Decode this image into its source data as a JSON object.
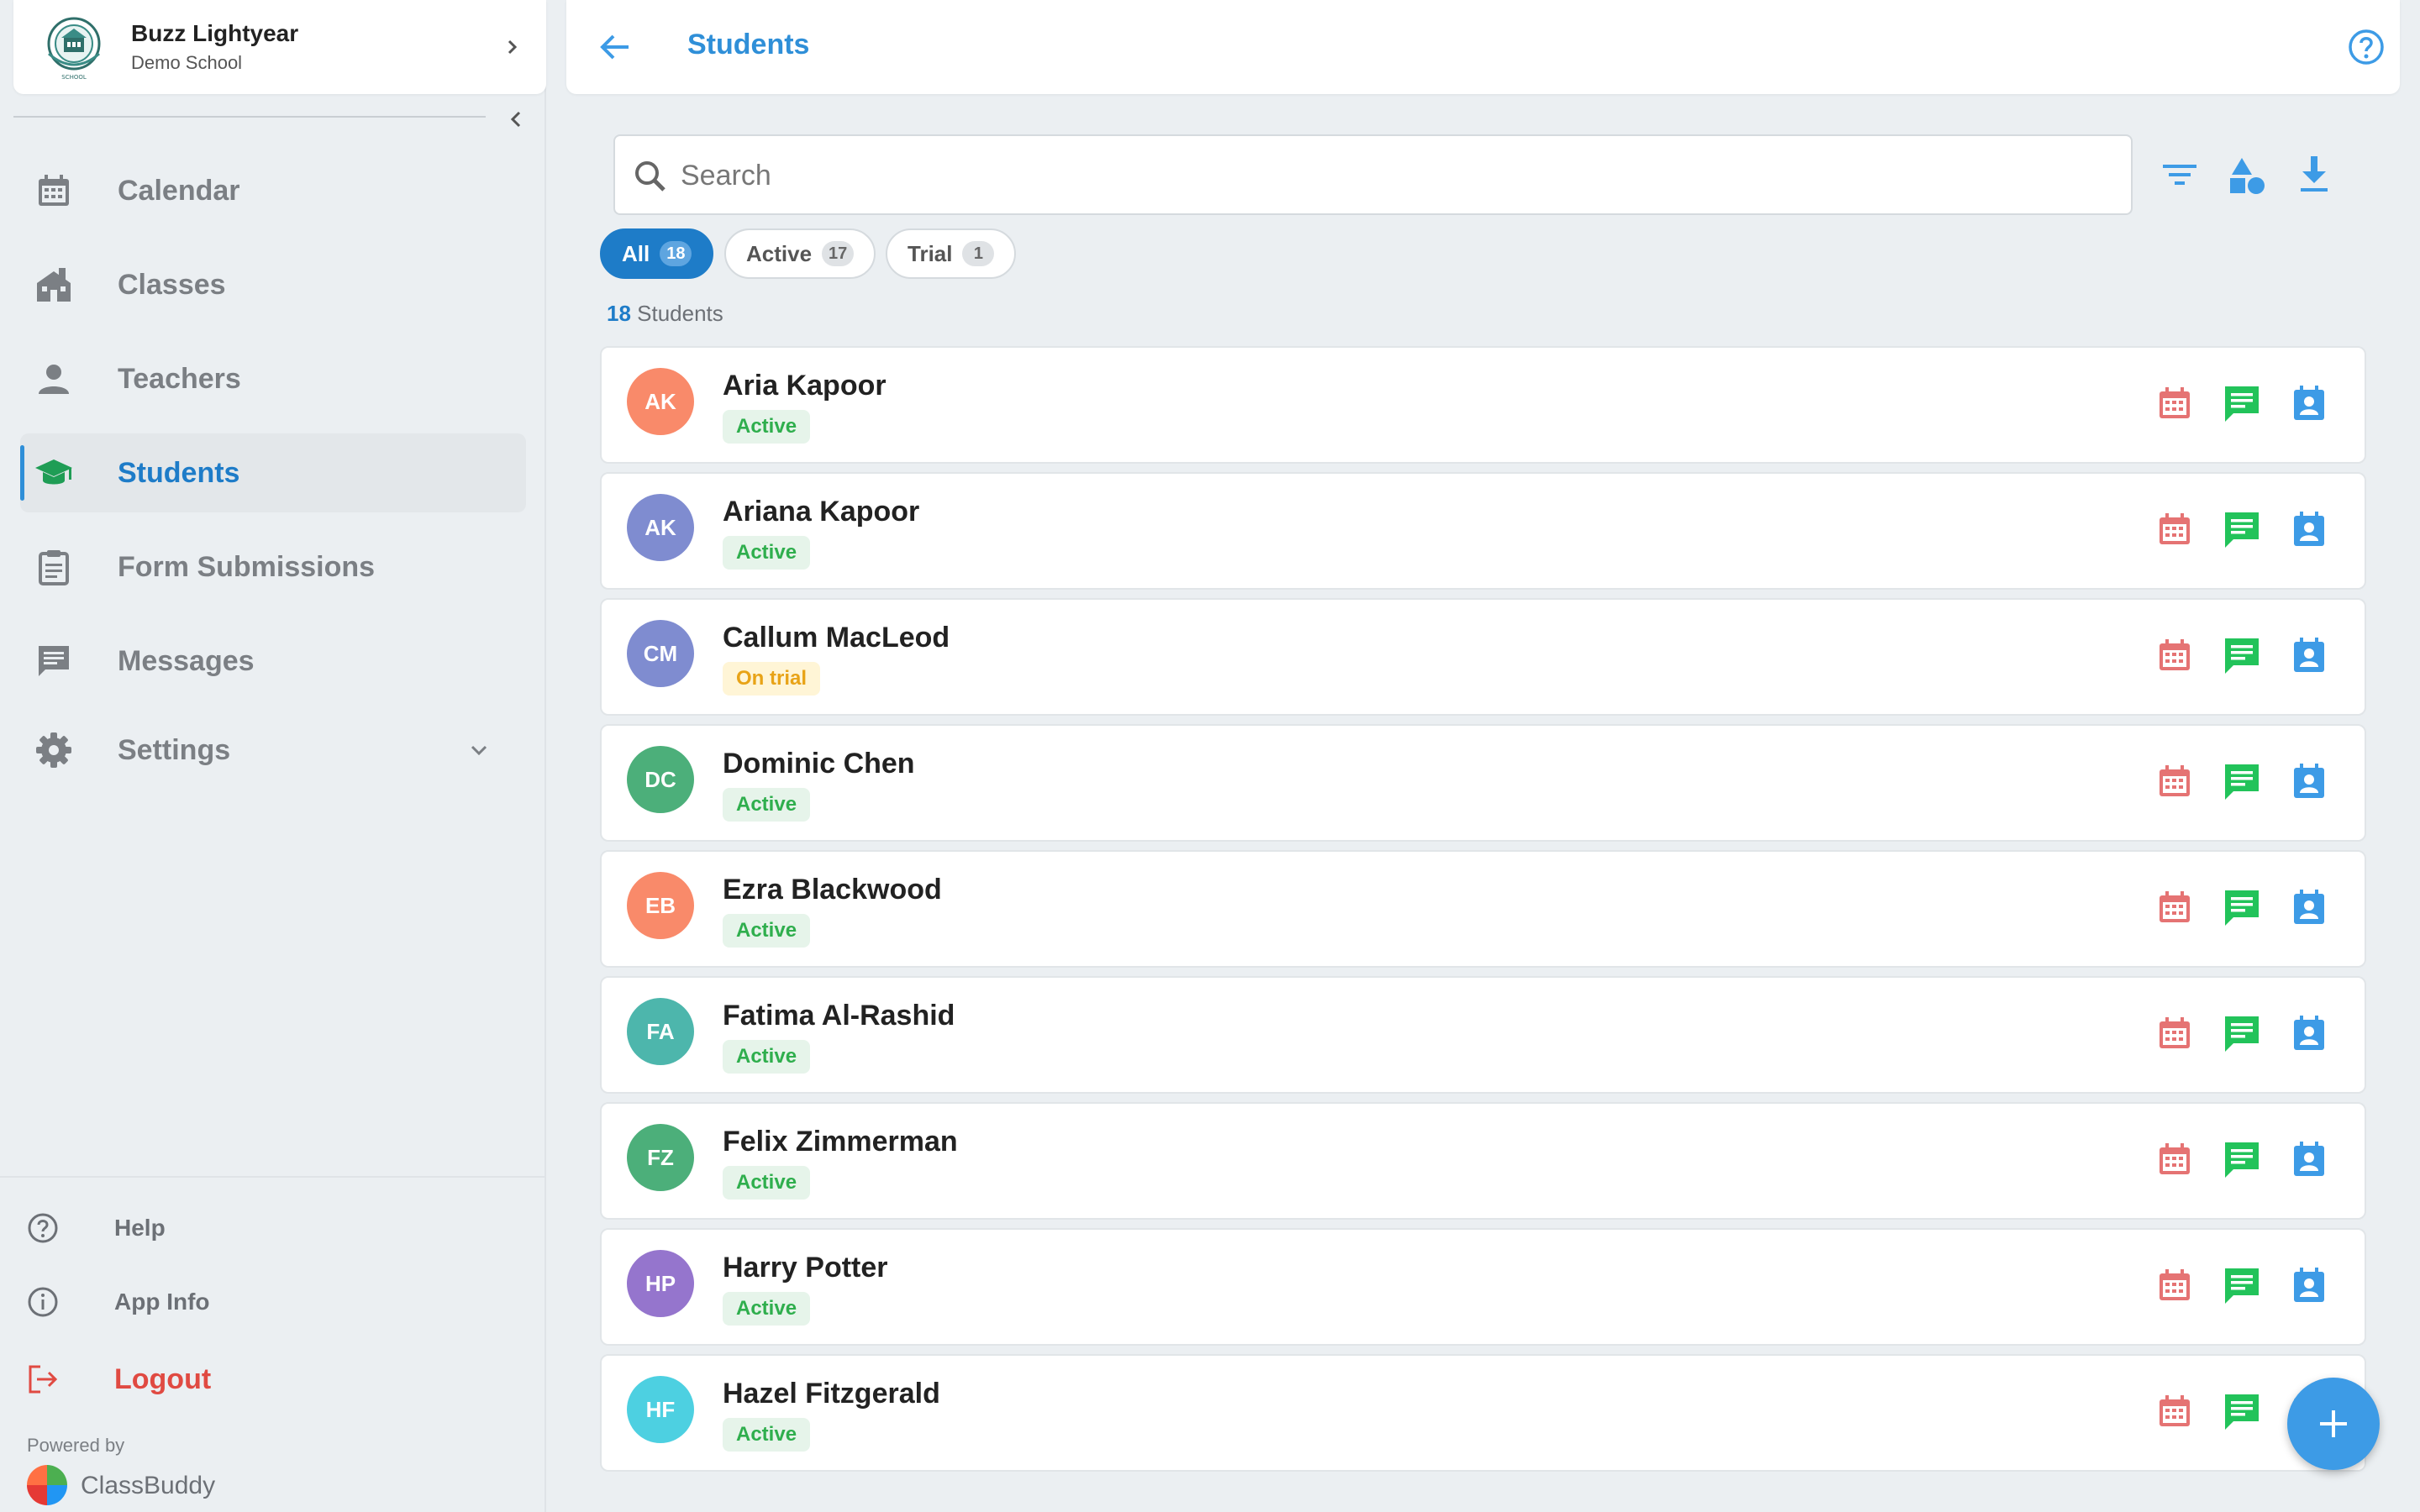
{
  "profile": {
    "name": "Buzz Lightyear",
    "school": "Demo School",
    "logo_icon": "school-crest-icon"
  },
  "sidebar": {
    "items": [
      {
        "label": "Calendar",
        "icon": "calendar-icon"
      },
      {
        "label": "Classes",
        "icon": "school-building-icon"
      },
      {
        "label": "Teachers",
        "icon": "person-icon"
      },
      {
        "label": "Students",
        "icon": "graduation-cap-icon",
        "active": true
      },
      {
        "label": "Form Submissions",
        "icon": "clipboard-icon"
      },
      {
        "label": "Messages",
        "icon": "message-icon"
      },
      {
        "label": "Settings",
        "icon": "gear-icon",
        "expandable": true
      }
    ],
    "bottom": [
      {
        "label": "Help",
        "icon": "help-icon"
      },
      {
        "label": "App Info",
        "icon": "info-icon"
      },
      {
        "label": "Logout",
        "icon": "logout-icon"
      }
    ],
    "powered_by": "Powered by",
    "brand": "ClassBuddy"
  },
  "header": {
    "title": "Students"
  },
  "search": {
    "placeholder": "Search",
    "value": ""
  },
  "filters": [
    {
      "label": "All",
      "count": "18",
      "selected": true
    },
    {
      "label": "Active",
      "count": "17",
      "selected": false
    },
    {
      "label": "Trial",
      "count": "1",
      "selected": false
    }
  ],
  "result": {
    "count": "18",
    "label": "Students"
  },
  "students": [
    {
      "initials": "AK",
      "name": "Aria Kapoor",
      "status": "Active",
      "color": "#f98a6a"
    },
    {
      "initials": "AK",
      "name": "Ariana Kapoor",
      "status": "Active",
      "color": "#7f8cd0"
    },
    {
      "initials": "CM",
      "name": "Callum MacLeod",
      "status": "On trial",
      "color": "#7f8cd0"
    },
    {
      "initials": "DC",
      "name": "Dominic Chen",
      "status": "Active",
      "color": "#4caf7a"
    },
    {
      "initials": "EB",
      "name": "Ezra Blackwood",
      "status": "Active",
      "color": "#f98a6a"
    },
    {
      "initials": "FA",
      "name": "Fatima Al-Rashid",
      "status": "Active",
      "color": "#4db6ac"
    },
    {
      "initials": "FZ",
      "name": "Felix Zimmerman",
      "status": "Active",
      "color": "#4caf7a"
    },
    {
      "initials": "HP",
      "name": "Harry Potter",
      "status": "Active",
      "color": "#9575cd"
    },
    {
      "initials": "HF",
      "name": "Hazel Fitzgerald",
      "status": "Active",
      "color": "#4dd0e1"
    }
  ],
  "colors": {
    "accent": "#1e7cc8",
    "calendar_action": "#e57373",
    "message_action": "#22c35a",
    "contact_action": "#3d9be6",
    "logout": "#e04a42"
  }
}
